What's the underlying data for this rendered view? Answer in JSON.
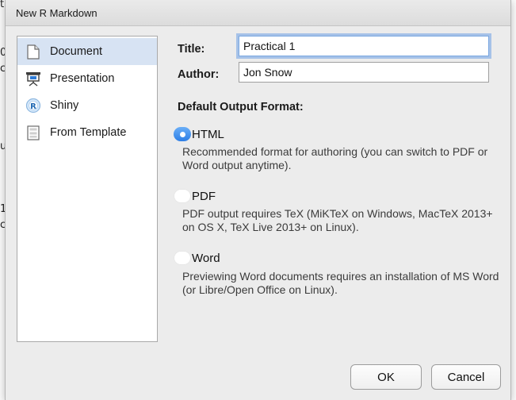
{
  "background": {
    "fragments": [
      "t",
      "0",
      "c",
      "u",
      "1",
      "c"
    ]
  },
  "dialog": {
    "title": "New R Markdown"
  },
  "sidebar": {
    "items": [
      {
        "label": "Document",
        "icon": "document-icon",
        "selected": true
      },
      {
        "label": "Presentation",
        "icon": "presentation-icon",
        "selected": false
      },
      {
        "label": "Shiny",
        "icon": "shiny-r-icon",
        "selected": false
      },
      {
        "label": "From Template",
        "icon": "template-icon",
        "selected": false
      }
    ]
  },
  "form": {
    "title_label": "Title:",
    "title_value": "Practical 1",
    "author_label": "Author:",
    "author_value": "Jon Snow",
    "output_heading": "Default Output Format:"
  },
  "formats": [
    {
      "label": "HTML",
      "selected": true,
      "description": "Recommended format for authoring (you can switch to PDF or Word output anytime)."
    },
    {
      "label": "PDF",
      "selected": false,
      "description": "PDF output requires TeX (MiKTeX on Windows, MacTeX 2013+ on OS X, TeX Live 2013+ on Linux)."
    },
    {
      "label": "Word",
      "selected": false,
      "description": "Previewing Word documents requires an installation of MS Word (or Libre/Open Office on Linux)."
    }
  ],
  "buttons": {
    "ok": "OK",
    "cancel": "Cancel"
  },
  "colors": {
    "selected_item_bg": "#d7e3f3",
    "radio_accent": "#2d7ee6",
    "focus_ring": "#6ea0e6"
  }
}
